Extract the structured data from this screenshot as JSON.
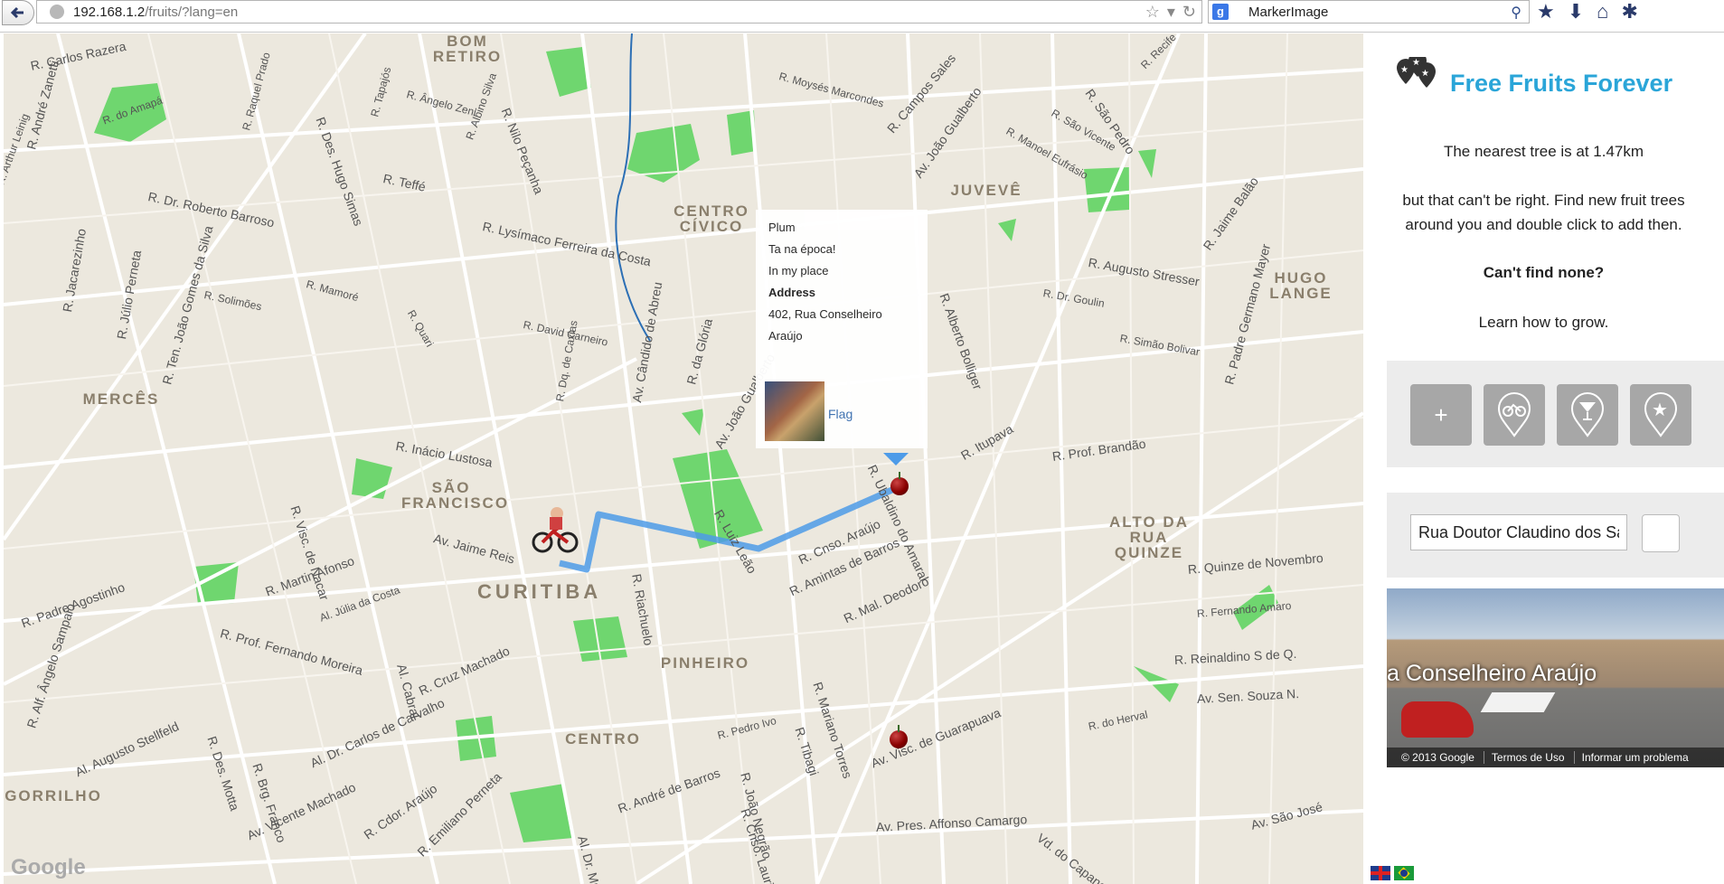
{
  "browser": {
    "url_host": "192.168.1.2",
    "url_path": "/fruits/?lang=en",
    "search_value": "MarkerImage"
  },
  "map": {
    "streets": [
      "R. Carlos Razera",
      "R. André Zanetti",
      "R. Arthur Leinig",
      "R. do Amapá",
      "R. Raquel Prado",
      "R. Des. Hugo Simas",
      "R. Tapajós",
      "R. Ângelo Zeni",
      "R. Albino Silva",
      "R. Nilo Peçanha",
      "R. Moysés Marcondes",
      "R. São Pedro",
      "R. Recife",
      "R. Campos Sales",
      "Av. João Gualberto",
      "R. Manoel Eufrásio",
      "R. São Vicente",
      "R. Teffé",
      "R. Dr. Roberto Barroso",
      "R. Lysímaco Ferreira da Costa",
      "R. Jacarezinho",
      "R. Júlio Perneta",
      "R. Ten. João Gomes da Silva",
      "R. Solimões",
      "R. Mamoré",
      "R. Quari",
      "R. David Carneiro",
      "R. Dq. de Caxias",
      "Av. Cândido de Abreu",
      "R. da Glória",
      "Av. João Gualberto",
      "R. Alberto Bolliger",
      "R. Augusto Stresser",
      "R. Jaime Balão",
      "R. Padre Germano Mayer",
      "R. Dr. Goulin",
      "R. Simão Bolivar",
      "R. Inácio Lustosa",
      "R. Visc. de Nacar",
      "Av. Jaime Reis",
      "R. Martin Afonso",
      "R. Padre Agostinho",
      "Al. Júlia da Costa",
      "Al. Cabral",
      "R. Riachuelo",
      "R. Luiz Leão",
      "R. Cnso. Araújo",
      "R. Amintas de Barros",
      "R. Ubaldino do Amaral",
      "R. Itupava",
      "R. Prof. Brandão",
      "R. Mal. Deodoro",
      "R. Quinze de Novembro",
      "R. Fernando Amaro",
      "R. Reinaldino S de Q.",
      "Av. Sen. Souza N.",
      "R. Prof. Fernando Moreira",
      "R. Cruz Machado",
      "Al. Dr. Carlos de Carvalho",
      "R. Brg. Franco",
      "R. Des. Motta",
      "Al. Augusto Stellfeld",
      "R. Alf. Ângelo Sampaio",
      "Av. Vicente Machado",
      "R. Cdor. Araújo",
      "R. Emiliano Perneta",
      "R. André de Barros",
      "R. João Negrão",
      "R. Tibagi",
      "R. Mariano Torres",
      "Av. Visc. de Guarapuava",
      "Av. Pres. Affonso Camargo",
      "Vd. do Capanema",
      "Av. São José",
      "R. do Herval",
      "R. Cnso. Laurindo",
      "R. Pedro Ivo",
      "Al. Dr. Muricy"
    ],
    "districts": [
      "BOM RETIRO",
      "CENTRO CÍVICO",
      "JUVEVÊ",
      "HUGO LANGE",
      "MERCÊS",
      "SÃO FRANCISCO",
      "ALTO DA RUA QUINZE",
      "PINHEIRO",
      "CENTRO",
      "GORRILHO"
    ],
    "city": "CURITIBA",
    "google_logo": "Google",
    "infowindow": {
      "name": "Plum",
      "season": "Ta na época!",
      "place": "In my place",
      "address_label": "Address",
      "address_line1": "402, Rua Conselheiro",
      "address_line2": "Araújo",
      "flag_label": "Flag"
    }
  },
  "sidebar": {
    "title": "Free Fruits Forever",
    "nearest": "The nearest tree is at 1.47km",
    "find_line1": "but that can't be right. Find new fruit trees",
    "find_line2": "around you and double click to add then.",
    "cant_find": "Can't find none?",
    "learn": "Learn how to grow.",
    "actions": [
      {
        "icon": "plus-icon",
        "label": "+"
      },
      {
        "icon": "bicycle-icon",
        "label": ""
      },
      {
        "icon": "cocktail-icon",
        "label": ""
      },
      {
        "icon": "star-icon",
        "label": ""
      }
    ],
    "address_value": "Rua Doutor Claudino dos Sa",
    "streetview": {
      "title": "a Conselheiro Araújo",
      "copyright": "© 2013 Google",
      "terms": "Termos de Uso",
      "report": "Informar um problema"
    }
  },
  "colors": {
    "brand": "#2aa5d8",
    "route": "#4d9be8",
    "park": "#6fd66f",
    "map_bg": "#ece8de"
  }
}
